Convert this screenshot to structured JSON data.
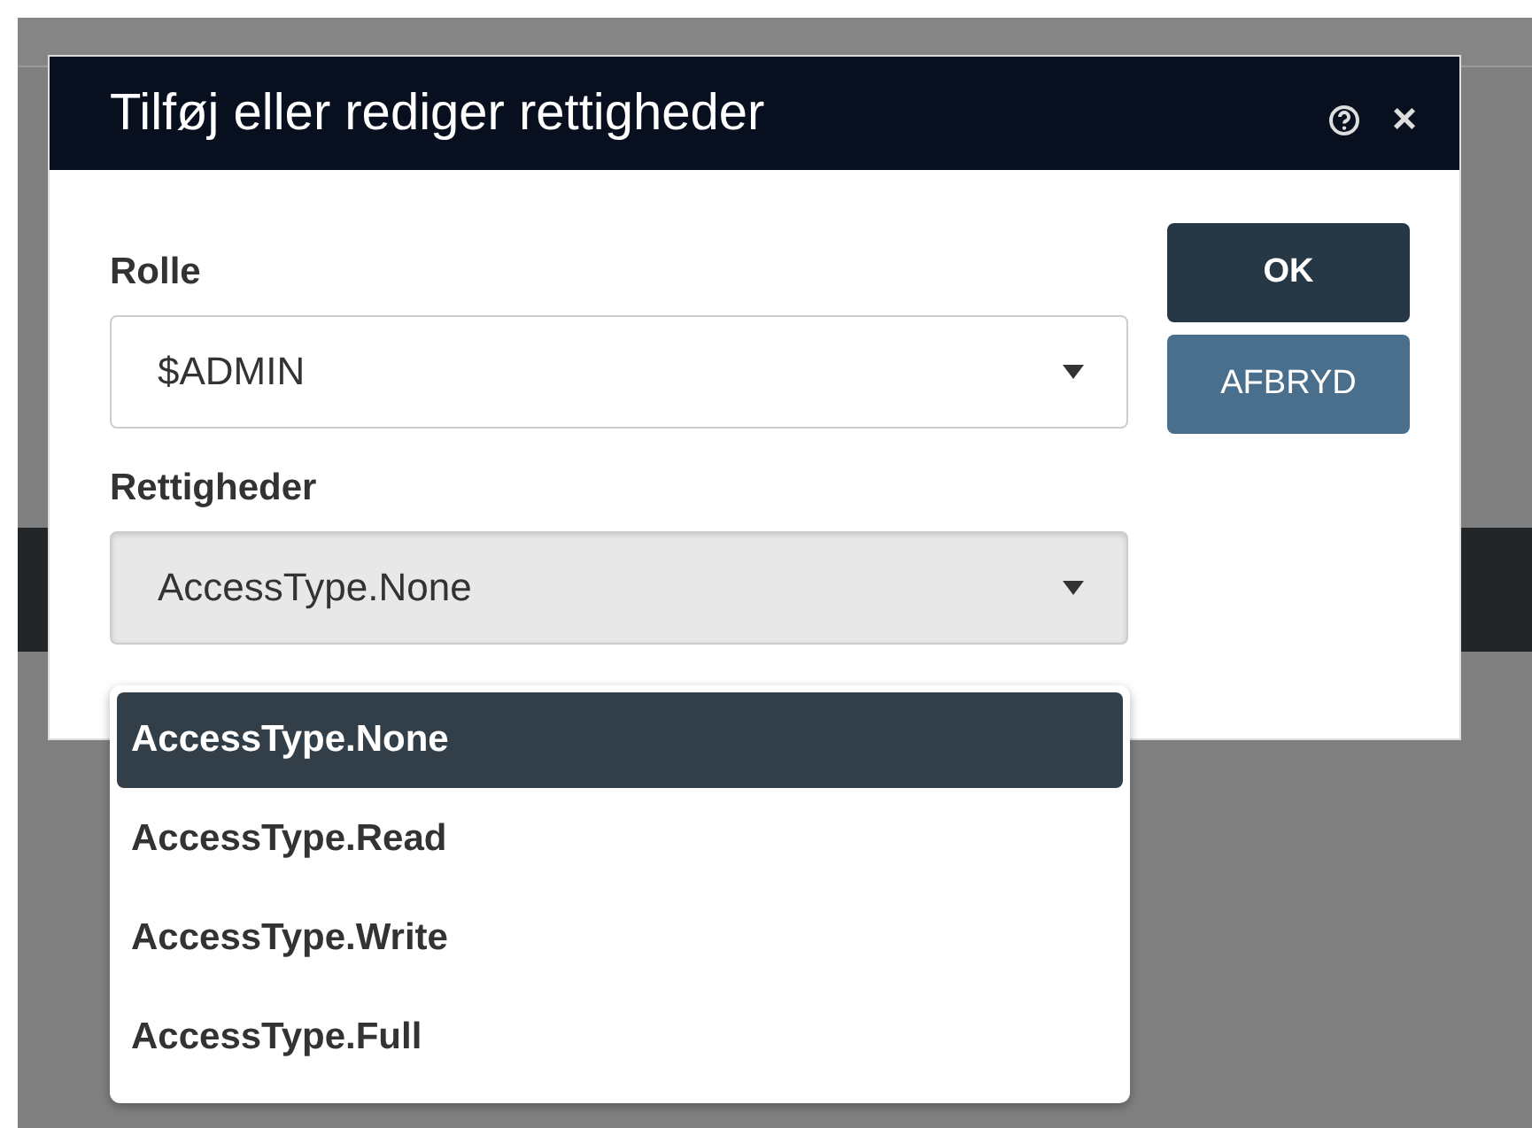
{
  "dialog": {
    "title": "Tilføj eller rediger rettigheder",
    "close": "×"
  },
  "fields": [
    {
      "label": "Rolle",
      "value": "$ADMIN",
      "active": false
    },
    {
      "label": "Rettigheder",
      "value": "AccessType.None",
      "active": true
    }
  ],
  "buttons": [
    {
      "label": "OK",
      "kind": "primary"
    },
    {
      "label": "AFBRYD",
      "kind": "secondary"
    }
  ],
  "dropdown": {
    "options": [
      {
        "label": "AccessType.None",
        "selected": true
      },
      {
        "label": "AccessType.Read",
        "selected": false
      },
      {
        "label": "AccessType.Write",
        "selected": false
      },
      {
        "label": "AccessType.Full",
        "selected": false
      }
    ]
  }
}
